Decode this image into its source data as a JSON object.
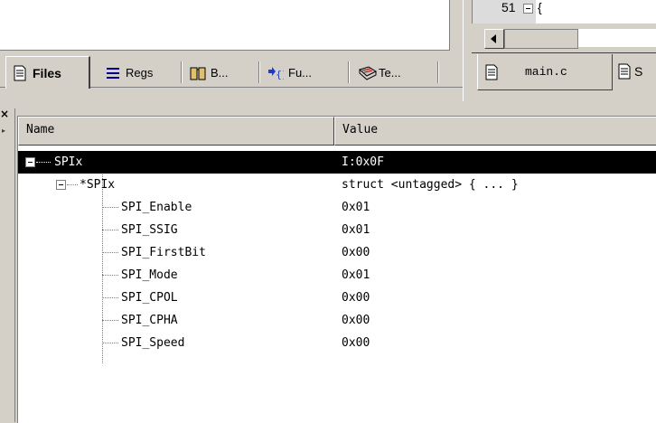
{
  "editor": {
    "line_number": "51",
    "code": "{"
  },
  "project_tabs": [
    {
      "label": "Files",
      "icon": "files-icon",
      "active": true
    },
    {
      "label": "Regs",
      "icon": "registers-icon",
      "active": false
    },
    {
      "label": "B...",
      "icon": "books-icon",
      "active": false
    },
    {
      "label": "Fu...",
      "icon": "functions-icon",
      "active": false
    },
    {
      "label": "Te...",
      "icon": "templates-icon",
      "active": false
    }
  ],
  "editor_tabs": [
    {
      "label": "main.c",
      "icon": "document-icon"
    },
    {
      "label": "S",
      "icon": "document-icon"
    }
  ],
  "watch": {
    "columns": {
      "name": "Name",
      "value": "Value"
    },
    "rows": [
      {
        "name": "SPIx",
        "value": "I:0x0F",
        "selected": true
      },
      {
        "name": "*SPIx",
        "value": "struct <untagged> { ... }"
      },
      {
        "name": "SPI_Enable",
        "value": "0x01"
      },
      {
        "name": "SPI_SSIG",
        "value": "0x01"
      },
      {
        "name": "SPI_FirstBit",
        "value": "0x00"
      },
      {
        "name": "SPI_Mode",
        "value": "0x01"
      },
      {
        "name": "SPI_CPOL",
        "value": "0x00"
      },
      {
        "name": "SPI_CPHA",
        "value": "0x00"
      },
      {
        "name": "SPI_Speed",
        "value": "0x00"
      }
    ]
  },
  "colors": {
    "selection_bg": "#000000",
    "panel_bg": "#d4d0c8"
  }
}
